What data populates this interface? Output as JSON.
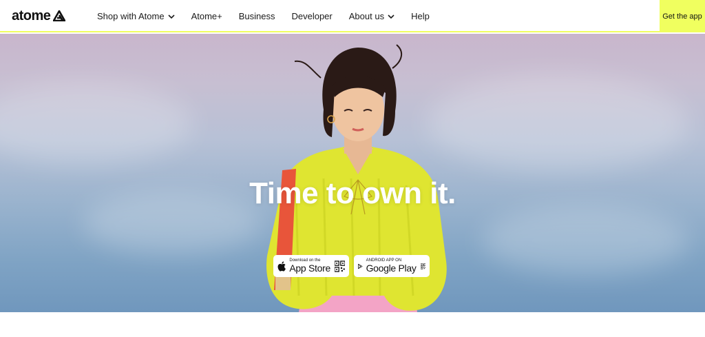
{
  "brand": {
    "name": "atome",
    "accent": "#f0ff5f"
  },
  "nav": {
    "items": [
      {
        "label": "Shop with Atome",
        "has_dropdown": true
      },
      {
        "label": "Atome+",
        "has_dropdown": false
      },
      {
        "label": "Business",
        "has_dropdown": false
      },
      {
        "label": "Developer",
        "has_dropdown": false
      },
      {
        "label": "About us",
        "has_dropdown": true
      },
      {
        "label": "Help",
        "has_dropdown": false
      }
    ],
    "cta": "Get the app"
  },
  "hero": {
    "headline": "Time to own it.",
    "app_store": {
      "small": "Download on the",
      "big": "App Store",
      "icon": "apple-icon"
    },
    "google_play": {
      "small": "ANDROID APP ON",
      "big": "Google Play",
      "icon": "google-play-icon"
    }
  }
}
